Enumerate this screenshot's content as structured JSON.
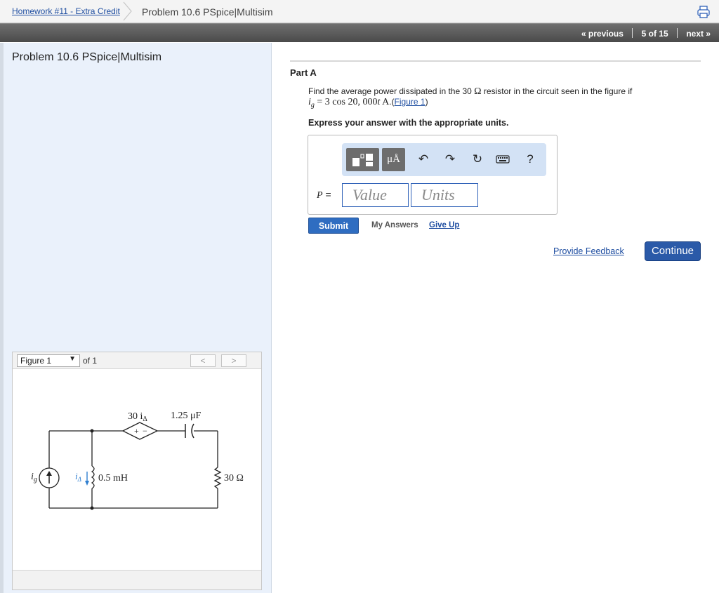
{
  "breadcrumb": {
    "assignment": "Homework #11 - Extra Credit",
    "current": "Problem 10.6 PSpice|Multisim"
  },
  "nav": {
    "previous": "« previous",
    "position": "5 of 15",
    "next": "next »"
  },
  "left": {
    "title": "Problem 10.6 PSpice|Multisim",
    "figure": {
      "selected": "Figure 1",
      "of": "of 1",
      "prev": "<",
      "next": ">",
      "circuit": {
        "dependent_source": "30 i",
        "dependent_source_sub": "Δ",
        "plus": "+",
        "minus": "−",
        "capacitor": "1.25 μF",
        "inductor": "0.5 mH",
        "resistor": "30 Ω",
        "current_source": "i",
        "current_source_sub": "g",
        "branch_current": "i",
        "branch_current_sub": "Δ"
      }
    }
  },
  "part": {
    "label": "Part A",
    "question_prefix": "Find the average power dissipated in the 30",
    "ohm": "Ω",
    "question_suffix": " resistor in the circuit seen in the figure if",
    "eq_var": "i",
    "eq_sub": "g",
    "eq_rest": " = 3 cos 20, 000",
    "eq_t": "t",
    "eq_unit": " A",
    "fig_open": ".(",
    "figure_link": "Figure 1",
    "fig_close": ")",
    "instruction": "Express your answer with the appropriate units."
  },
  "answer": {
    "variable": "P",
    "eq": " =",
    "unit_button": "μÅ",
    "help": "?",
    "value_placeholder": "Value",
    "units_placeholder": "Units",
    "icons": [
      "fraction-template-icon",
      "units-icon",
      "undo-icon",
      "redo-icon",
      "reset-icon",
      "keyboard-icon",
      "help-icon"
    ]
  },
  "actions": {
    "submit": "Submit",
    "my_answers": "My Answers",
    "give_up": "Give Up",
    "feedback": "Provide Feedback",
    "continue": "Continue"
  },
  "colors": {
    "link": "#1f4ea1",
    "submit": "#2f6dc1",
    "continue": "#2b5aa8",
    "left_pane": "#eaf1fb",
    "toolbar": "#d3e2f5"
  }
}
